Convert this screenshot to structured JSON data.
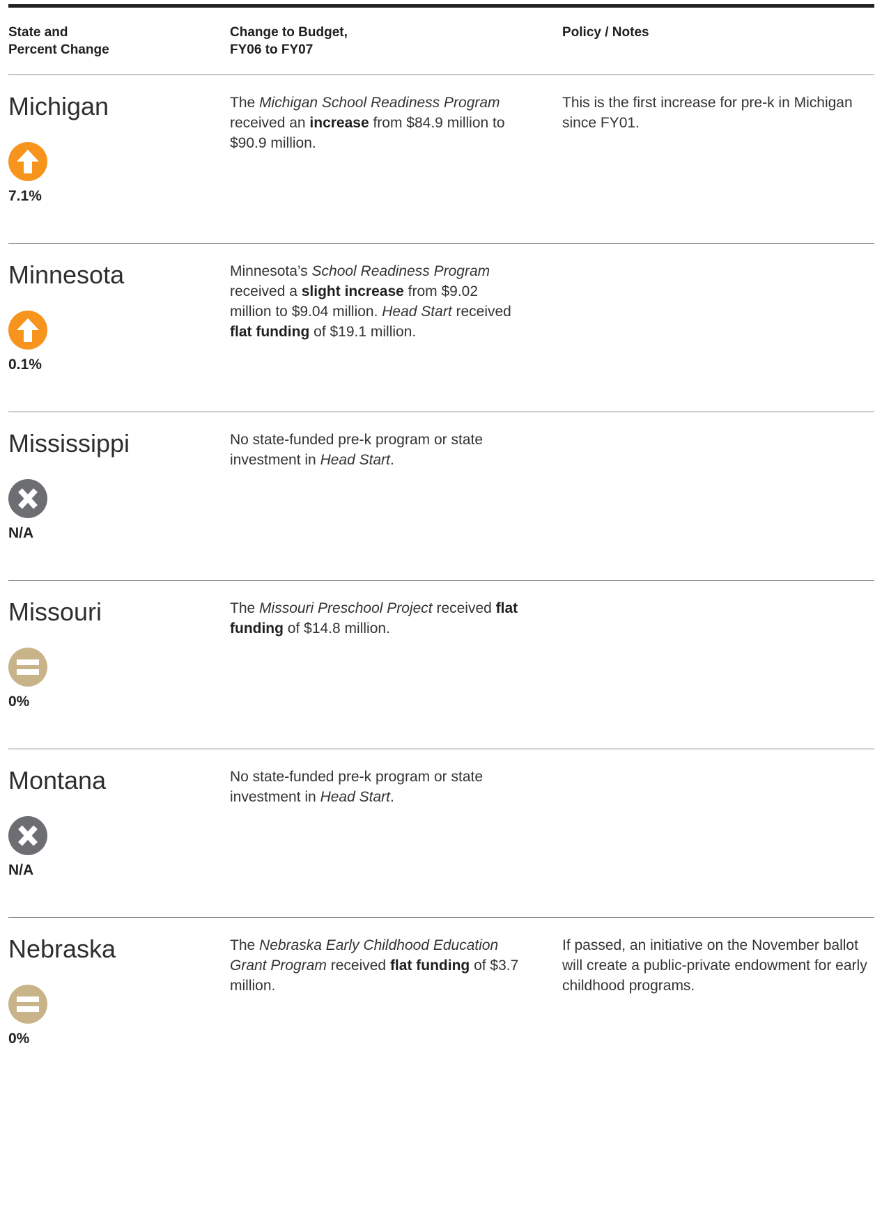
{
  "header": {
    "col1_line1": "State and",
    "col1_line2": "Percent Change",
    "col2_line1": "Change to Budget,",
    "col2_line2": "FY06 to FY07",
    "col3": "Policy / Notes"
  },
  "colors": {
    "increase": "#f7941d",
    "none": "#6d6e71",
    "flat": "#c9b48a",
    "rule": "#8a8a8a",
    "topbar": "#222222"
  },
  "rows": [
    {
      "state": "Michigan",
      "icon": "arrow-up-icon",
      "percent": "7.1%",
      "budget": [
        {
          "t": "The "
        },
        {
          "t": "Michigan School Readiness Program",
          "s": "i"
        },
        {
          "t": " received an "
        },
        {
          "t": "increase",
          "s": "b"
        },
        {
          "t": " from $84.9 million to $90.9 million."
        }
      ],
      "notes": "This is the first increase for pre-k in Michigan since FY01."
    },
    {
      "state": "Minnesota",
      "icon": "arrow-up-icon",
      "percent": "0.1%",
      "budget": [
        {
          "t": "Minnesota’s "
        },
        {
          "t": "School Readiness Program",
          "s": "i"
        },
        {
          "t": " received a "
        },
        {
          "t": "slight increase",
          "s": "b"
        },
        {
          "t": " from $9.02 million to $9.04 million. "
        },
        {
          "t": "Head Start",
          "s": "i"
        },
        {
          "t": " received "
        },
        {
          "t": "flat funding",
          "s": "b"
        },
        {
          "t": " of $19.1 million."
        }
      ],
      "notes": ""
    },
    {
      "state": "Mississippi",
      "icon": "x-icon",
      "percent": "N/A",
      "budget": [
        {
          "t": "No state-funded pre-k program or state investment in "
        },
        {
          "t": "Head Start",
          "s": "i"
        },
        {
          "t": "."
        }
      ],
      "notes": ""
    },
    {
      "state": "Missouri",
      "icon": "equals-icon",
      "percent": "0%",
      "budget": [
        {
          "t": "The "
        },
        {
          "t": "Missouri Preschool Project",
          "s": "i"
        },
        {
          "t": " received "
        },
        {
          "t": "flat funding",
          "s": "b"
        },
        {
          "t": " of $14.8 million."
        }
      ],
      "notes": ""
    },
    {
      "state": "Montana",
      "icon": "x-icon",
      "percent": "N/A",
      "budget": [
        {
          "t": "No state-funded pre-k program or state investment in "
        },
        {
          "t": "Head Start",
          "s": "i"
        },
        {
          "t": "."
        }
      ],
      "notes": ""
    },
    {
      "state": "Nebraska",
      "icon": "equals-icon",
      "percent": "0%",
      "budget": [
        {
          "t": "The "
        },
        {
          "t": "Nebraska Early Childhood Education Grant Program",
          "s": "i"
        },
        {
          "t": " received "
        },
        {
          "t": "flat funding",
          "s": "b"
        },
        {
          "t": " of $3.7 million."
        }
      ],
      "notes": "If passed, an initiative on the November ballot will create a public-private endowment for early childhood programs."
    }
  ]
}
